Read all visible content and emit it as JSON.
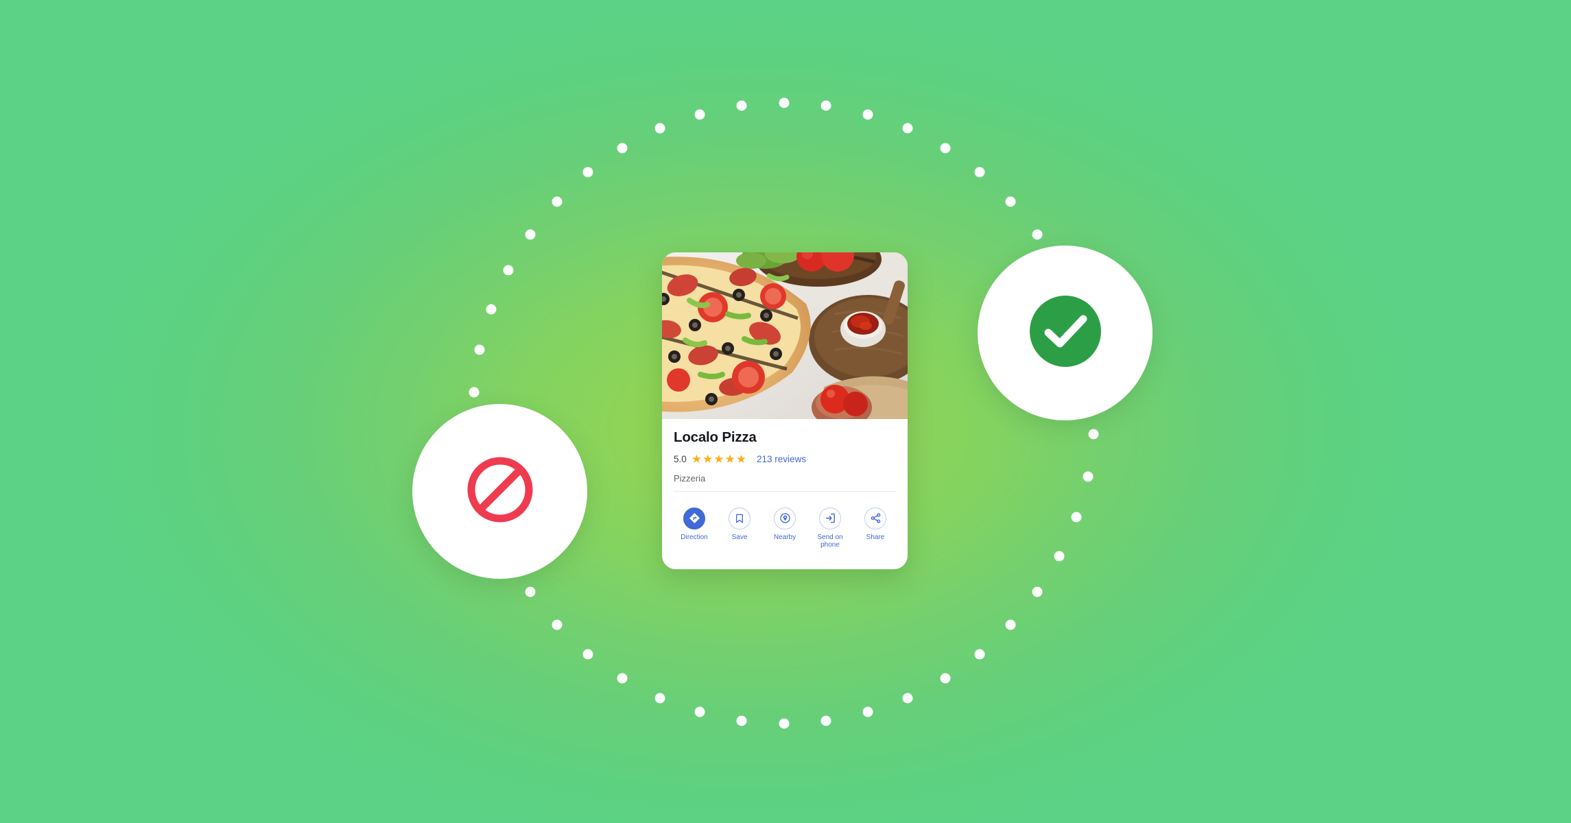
{
  "background": {
    "gradient_center_color": "#95d54e",
    "gradient_edge_color": "#5bd285",
    "dot_color": "#ffffff",
    "dot_count": 46
  },
  "badges": {
    "blocked": {
      "icon": "prohibition-icon",
      "color": "#ef3b50",
      "circle_color": "#ffffff"
    },
    "verified": {
      "icon": "check-circle-icon",
      "color": "#2c9f46",
      "check_color": "#ffffff",
      "circle_color": "#ffffff"
    }
  },
  "place_card": {
    "photo_alt": "pizza-photo",
    "title": "Localo Pizza",
    "rating_value": "5.0",
    "stars_filled": 5,
    "star_color": "#fbaf17",
    "review_count": "213 reviews",
    "category": "Pizzeria",
    "link_color": "#4267d6",
    "actions": [
      {
        "label": "Direction",
        "icon": "direction-arrow-icon",
        "primary": true
      },
      {
        "label": "Save",
        "icon": "bookmark-icon",
        "primary": false
      },
      {
        "label": "Nearby",
        "icon": "location-pin-icon",
        "primary": false
      },
      {
        "label": "Send on phone",
        "icon": "send-to-device-icon",
        "primary": false
      },
      {
        "label": "Share",
        "icon": "share-nodes-icon",
        "primary": false
      }
    ]
  }
}
